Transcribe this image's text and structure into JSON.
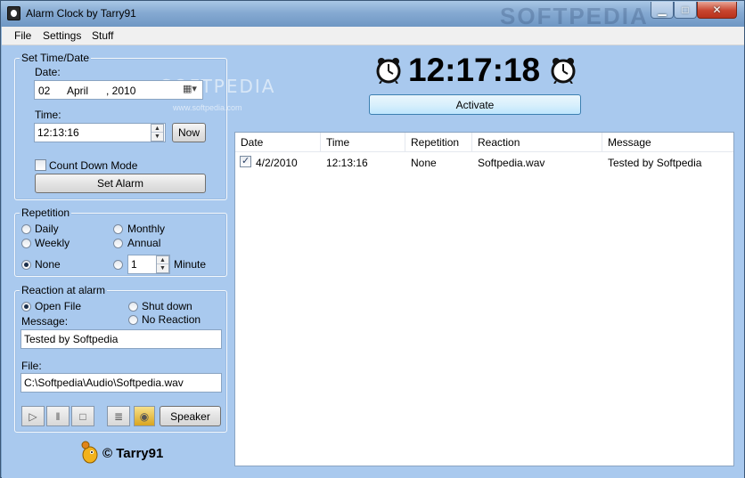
{
  "window": {
    "title": "Alarm Clock by Tarry91",
    "watermark": "SOFTPEDIA"
  },
  "menu": [
    "File",
    "Settings",
    "Stuff"
  ],
  "set_time": {
    "group_title": "Set Time/Date",
    "date_label": "Date:",
    "day": "02",
    "month": "April",
    "year": ", 2010",
    "time_label": "Time:",
    "time_value": "12:13:16",
    "now_label": "Now",
    "countdown_label": "Count Down Mode",
    "set_alarm_label": "Set Alarm"
  },
  "repetition": {
    "group_title": "Repetition",
    "daily": "Daily",
    "monthly": "Monthly",
    "weekly": "Weekly",
    "annual": "Annual",
    "none": "None",
    "minute_value": "1",
    "minute_label": "Minute"
  },
  "reaction": {
    "group_title": "Reaction at alarm",
    "open_file": "Open File",
    "shut_down": "Shut down",
    "no_reaction": "No Reaction",
    "message_label": "Message:",
    "message_value": "Tested by Softpedia",
    "file_label": "File:",
    "file_value": "C:\\Softpedia\\Audio\\Softpedia.wav",
    "speaker_label": "Speaker"
  },
  "clock": {
    "time": "12:17:18",
    "activate_label": "Activate"
  },
  "list": {
    "columns": [
      "Date",
      "Time",
      "Repetition",
      "Reaction",
      "Message"
    ],
    "rows": [
      {
        "checked": true,
        "date": "4/2/2010",
        "time": "12:13:16",
        "repetition": "None",
        "reaction": "Softpedia.wav",
        "message": "Tested by Softpedia"
      }
    ]
  },
  "footer": {
    "text": "© Tarry91"
  },
  "watermark": {
    "brand": "SOFTPEDIA",
    "url": "www.softpedia.com"
  },
  "colors": {
    "background": "#a9c9ee",
    "accent": "#3b5878"
  }
}
